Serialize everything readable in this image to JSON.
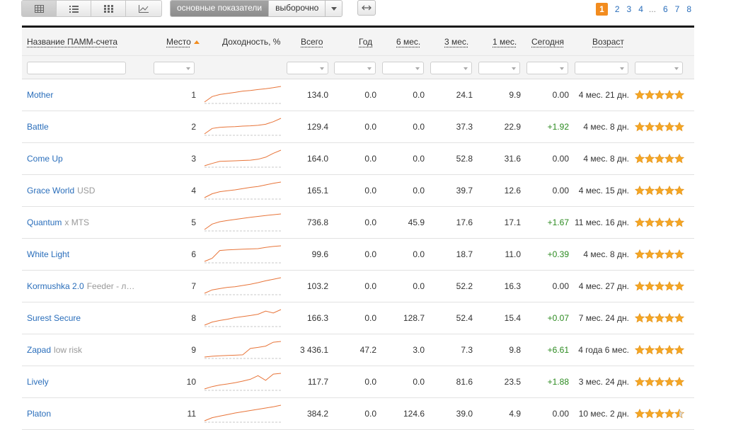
{
  "toolbar": {
    "views": [
      {
        "icon": "grid-icon",
        "active": true
      },
      {
        "icon": "list-icon",
        "active": false
      },
      {
        "icon": "tiles-icon",
        "active": false
      },
      {
        "icon": "chart-icon",
        "active": false
      }
    ],
    "tab_main": "основные показатели",
    "tab_custom": "выборочно",
    "expand_icon": "expand-horizontal-icon"
  },
  "pagination": {
    "pages_start": [
      "1",
      "2",
      "3",
      "4"
    ],
    "ellipsis": "...",
    "pages_end": [
      "6",
      "7",
      "8"
    ],
    "current": "1"
  },
  "columns": {
    "name": "Название ПАММ-счета",
    "place": "Место",
    "yield": "Доходность, %",
    "total": "Всего",
    "year": "Год",
    "m6": "6 мес.",
    "m3": "3 мес.",
    "m1": "1 мес.",
    "today": "Сегодня",
    "age": "Возраст"
  },
  "colors": {
    "accent": "#f28c1f",
    "link": "#2a6ebb",
    "positive": "#2b8a1f",
    "spark": "#e8753a",
    "star": "#f5a623"
  },
  "rows": [
    {
      "name": "Mother",
      "sub": "",
      "place": "1",
      "total": "134.0",
      "year": "0.0",
      "m6": "0.0",
      "m3": "24.1",
      "m1": "9.9",
      "today": "0.00",
      "age": "4 мес. 21 дн.",
      "rating": 5,
      "spark": [
        0,
        0.35,
        0.48,
        0.55,
        0.62,
        0.7,
        0.74,
        0.8,
        0.85,
        0.92,
        1.0
      ]
    },
    {
      "name": "Battle",
      "sub": "",
      "place": "2",
      "total": "129.4",
      "year": "0.0",
      "m6": "0.0",
      "m3": "37.3",
      "m1": "22.9",
      "today": "+1.92",
      "age": "4 мес. 8 дн.",
      "rating": 5,
      "spark": [
        0,
        0.35,
        0.42,
        0.45,
        0.47,
        0.5,
        0.52,
        0.55,
        0.62,
        0.78,
        1.0
      ]
    },
    {
      "name": "Come Up",
      "sub": "",
      "place": "3",
      "total": "164.0",
      "year": "0.0",
      "m6": "0.0",
      "m3": "52.8",
      "m1": "31.6",
      "today": "0.00",
      "age": "4 мес. 8 дн.",
      "rating": 5,
      "spark": [
        0,
        0.15,
        0.28,
        0.3,
        0.32,
        0.34,
        0.36,
        0.42,
        0.55,
        0.8,
        1.0
      ]
    },
    {
      "name": "Grace World",
      "sub": "USD",
      "place": "4",
      "total": "165.1",
      "year": "0.0",
      "m6": "0.0",
      "m3": "39.7",
      "m1": "12.6",
      "today": "0.00",
      "age": "4 мес. 15 дн.",
      "rating": 5,
      "spark": [
        0,
        0.25,
        0.38,
        0.44,
        0.5,
        0.58,
        0.66,
        0.72,
        0.82,
        0.92,
        1.0
      ]
    },
    {
      "name": "Quantum",
      "sub": "x MTS",
      "place": "5",
      "total": "736.8",
      "year": "0.0",
      "m6": "45.9",
      "m3": "17.6",
      "m1": "17.1",
      "today": "+1.67",
      "age": "11 мес. 16 дн.",
      "rating": 5,
      "spark": [
        0,
        0.35,
        0.5,
        0.58,
        0.65,
        0.72,
        0.78,
        0.84,
        0.9,
        0.95,
        1.0
      ]
    },
    {
      "name": "White Light",
      "sub": "",
      "place": "6",
      "total": "99.6",
      "year": "0.0",
      "m6": "0.0",
      "m3": "18.7",
      "m1": "11.0",
      "today": "+0.39",
      "age": "4 мес. 8 дн.",
      "rating": 5,
      "spark": [
        0,
        0.2,
        0.7,
        0.74,
        0.76,
        0.78,
        0.8,
        0.82,
        0.9,
        0.96,
        1.0
      ]
    },
    {
      "name": "Kormushka 2.0",
      "sub": "Feeder - л…",
      "place": "7",
      "total": "103.2",
      "year": "0.0",
      "m6": "0.0",
      "m3": "52.2",
      "m1": "16.3",
      "today": "0.00",
      "age": "4 мес. 27 дн.",
      "rating": 5,
      "spark": [
        0,
        0.22,
        0.3,
        0.38,
        0.42,
        0.5,
        0.58,
        0.68,
        0.8,
        0.9,
        1.0
      ]
    },
    {
      "name": "Surest Secure",
      "sub": "",
      "place": "8",
      "total": "166.3",
      "year": "0.0",
      "m6": "128.7",
      "m3": "52.4",
      "m1": "15.4",
      "today": "+0.07",
      "age": "7 мес. 24 дн.",
      "rating": 5,
      "spark": [
        0,
        0.2,
        0.3,
        0.38,
        0.48,
        0.55,
        0.62,
        0.7,
        0.9,
        0.78,
        1.0
      ]
    },
    {
      "name": "Zapad",
      "sub": "low risk",
      "place": "9",
      "total": "3 436.1",
      "year": "47.2",
      "m6": "3.0",
      "m3": "7.3",
      "m1": "9.8",
      "today": "+6.61",
      "age": "4 года 6 мес.",
      "rating": 5,
      "spark": [
        0,
        0.05,
        0.08,
        0.1,
        0.12,
        0.14,
        0.55,
        0.62,
        0.7,
        0.95,
        1.0
      ]
    },
    {
      "name": "Lively",
      "sub": "",
      "place": "10",
      "total": "117.7",
      "year": "0.0",
      "m6": "0.0",
      "m3": "81.6",
      "m1": "23.5",
      "today": "+1.88",
      "age": "3 мес. 24 дн.",
      "rating": 5,
      "spark": [
        0,
        0.15,
        0.25,
        0.32,
        0.4,
        0.5,
        0.62,
        0.85,
        0.55,
        0.95,
        1.0
      ]
    },
    {
      "name": "Platon",
      "sub": "",
      "place": "11",
      "total": "384.2",
      "year": "0.0",
      "m6": "124.6",
      "m3": "39.0",
      "m1": "4.9",
      "today": "0.00",
      "age": "10 мес. 2 дн.",
      "rating": 4.5,
      "spark": [
        0,
        0.2,
        0.3,
        0.4,
        0.5,
        0.58,
        0.66,
        0.74,
        0.82,
        0.9,
        1.0
      ]
    }
  ]
}
